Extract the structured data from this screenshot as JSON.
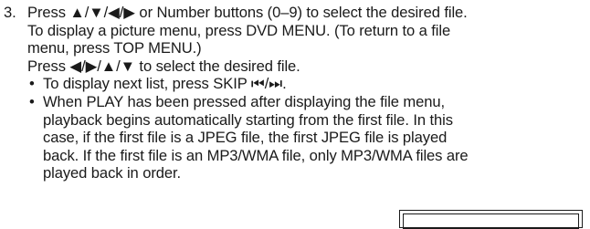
{
  "step": {
    "number": "3.",
    "lines": [
      "Press ▲/▼/◀/▶ or Number buttons (0–9) to select the desired file.",
      "To display a picture menu, press DVD MENU. (To return to a file",
      "menu, press TOP MENU.)",
      "Press ◀/▶/▲/▼ to select the desired file."
    ],
    "bullets": [
      {
        "marker": "•",
        "lines": [
          "To display next list, press SKIP ⏮/⏭."
        ]
      },
      {
        "marker": "•",
        "lines": [
          "When PLAY has been pressed after displaying the file menu,",
          "playback begins automatically starting from the first file. In this",
          "case, if the first file is a JPEG file, the first JPEG file is played",
          "back. If the first file is an MP3/WMA file, only MP3/WMA files are",
          "played back in order."
        ]
      }
    ]
  },
  "icons": {
    "bullet": "bullet-dot",
    "screen_box": "tv-screen-frame"
  }
}
